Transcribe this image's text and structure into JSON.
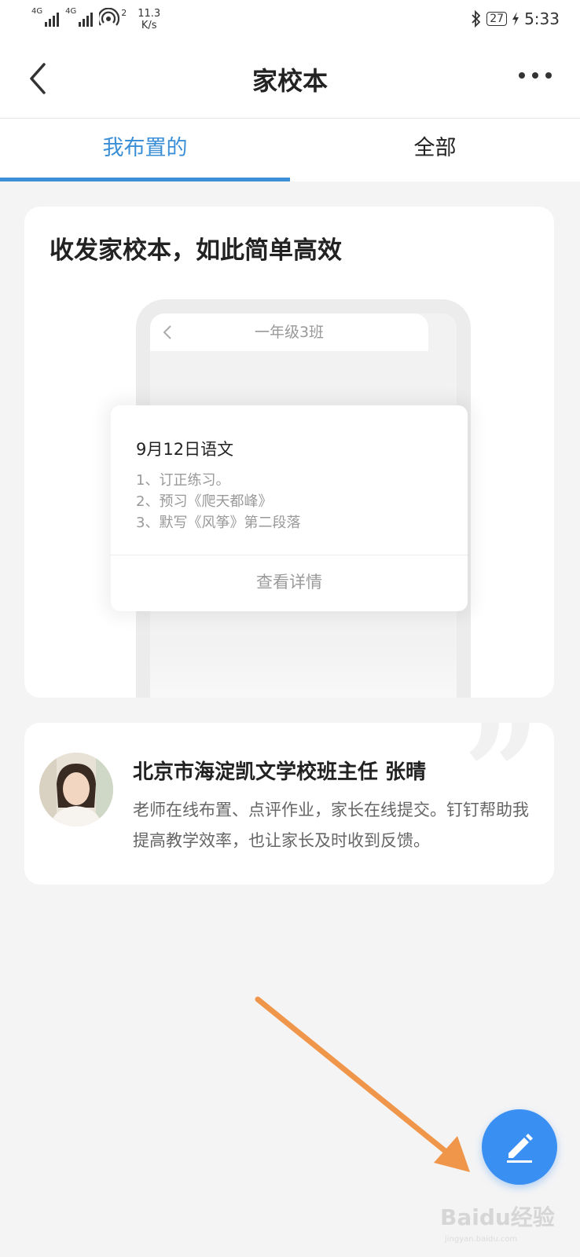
{
  "status_bar": {
    "net1": "4G",
    "net2": "4G",
    "hotspot_count": "2",
    "speed_value": "11.3",
    "speed_unit": "K/s",
    "battery": "27",
    "time": "5:33"
  },
  "nav": {
    "title": "家校本"
  },
  "tabs": [
    {
      "label": "我布置的",
      "active": true
    },
    {
      "label": "全部",
      "active": false
    }
  ],
  "promo": {
    "title": "收发家校本，如此简单高效",
    "phone_header": "一年级3班",
    "homework": {
      "title": "9月12日语文",
      "lines": [
        "1、订正练习。",
        "2、预习《爬天都峰》",
        "3、默写《风筝》第二段落"
      ],
      "detail_label": "查看详情"
    }
  },
  "testimonial": {
    "name": "北京市海淀凯文学校班主任 张晴",
    "text": "老师在线布置、点评作业，家长在线提交。钉钉帮助我提高教学效率，也让家长及时收到反馈。"
  },
  "watermark": {
    "brand": "Baidu经验",
    "url": "jingyan.baidu.com"
  },
  "colors": {
    "accent": "#3b8fd6",
    "fab": "#3a8ff2",
    "arrow": "#f0964a"
  },
  "icons": [
    "back-icon",
    "more-icon",
    "edit-icon",
    "quote-icon",
    "bluetooth-icon",
    "charging-icon"
  ]
}
